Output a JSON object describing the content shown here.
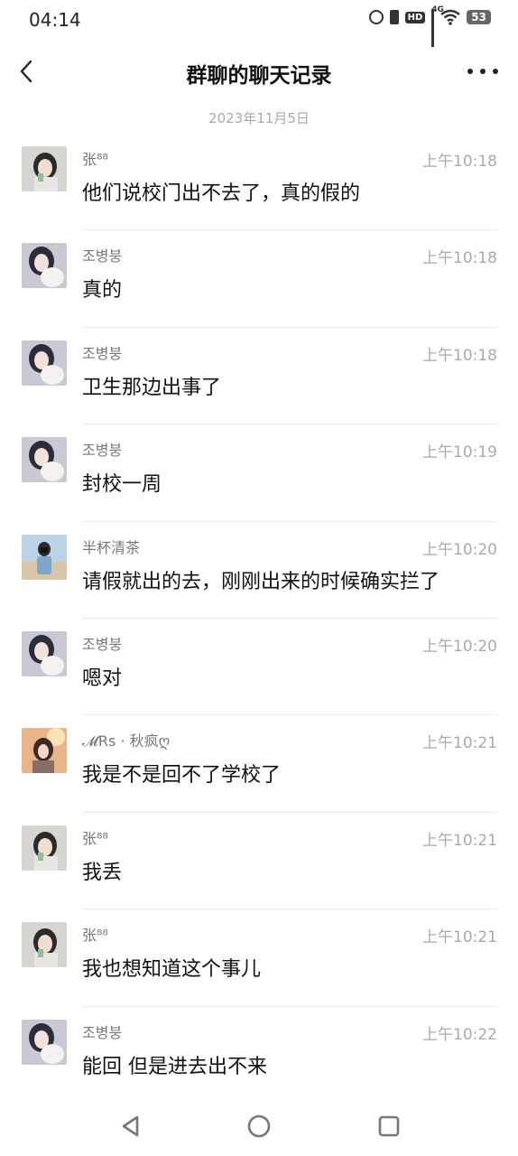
{
  "status_bar": {
    "time": "04:14",
    "network": "4G",
    "hd": "HD",
    "battery": "53",
    "icons": [
      "alarm-icon",
      "vibrate-icon",
      "hd-icon",
      "signal-icon",
      "wifi-icon",
      "battery-icon"
    ]
  },
  "header": {
    "title": "群聊的聊天记录",
    "back_icon": "chevron-left-icon",
    "more_icon": "more-dots-icon"
  },
  "date_label": "2023年11月5日",
  "messages": [
    {
      "name": "张⁸⁸",
      "time": "上午10:18",
      "text": "他们说校门出不去了，真的假的"
    },
    {
      "name": "조병붕",
      "time": "上午10:18",
      "text": "真的"
    },
    {
      "name": "조병붕",
      "time": "上午10:18",
      "text": "卫生那边出事了"
    },
    {
      "name": "조병붕",
      "time": "上午10:19",
      "text": "封校一周"
    },
    {
      "name": "半杯清茶",
      "time": "上午10:20",
      "text": "请假就出的去，刚刚出来的时候确实拦了"
    },
    {
      "name": "조병붕",
      "time": "上午10:20",
      "text": "嗯对"
    },
    {
      "name": "𝓜Rs · 秋疯ღ",
      "time": "上午10:21",
      "text": "我是不是回不了学校了"
    },
    {
      "name": "张⁸⁸",
      "time": "上午10:21",
      "text": "我丢"
    },
    {
      "name": "张⁸⁸",
      "time": "上午10:21",
      "text": "我也想知道这个事儿"
    },
    {
      "name": "조병붕",
      "time": "上午10:22",
      "text": "能回 但是进去出不来"
    }
  ],
  "nav_bar": {
    "icons": [
      "back-triangle-icon",
      "home-circle-icon",
      "recents-square-icon"
    ]
  },
  "colors": {
    "background": "#ffffff",
    "text_primary": "#111111",
    "text_secondary": "#777777",
    "timestamp": "#aaaaaa"
  }
}
